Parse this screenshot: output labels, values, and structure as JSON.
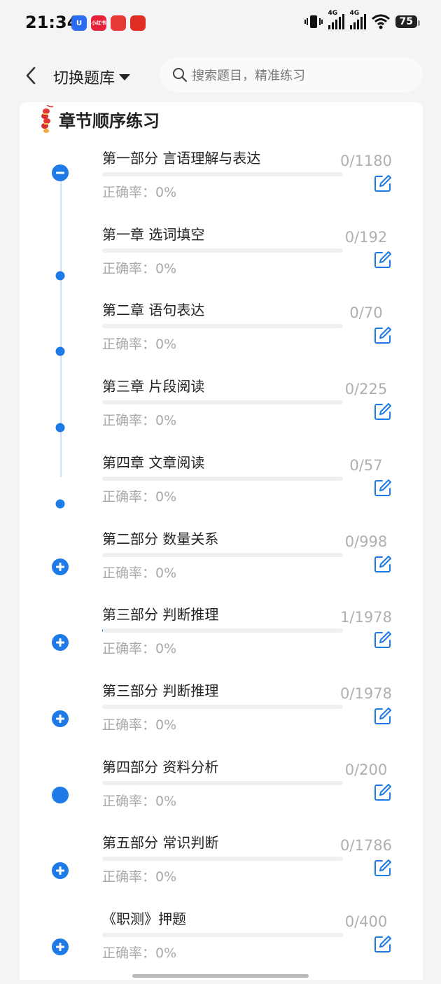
{
  "status": {
    "time": "21:34",
    "apps": [
      {
        "name": "app-u-icon",
        "color": "#2b6cf0",
        "label": "U"
      },
      {
        "name": "app-xiaohongshu-icon",
        "color": "#e5223a",
        "label": "小红书"
      },
      {
        "name": "app-red-tent-icon",
        "color": "#e53935",
        "label": ""
      },
      {
        "name": "app-pinduoduo-icon",
        "color": "#e02e24",
        "label": ""
      }
    ],
    "signal_label_1": "4G",
    "signal_label_2": "4G",
    "battery": "75"
  },
  "header": {
    "switch_label": "切换题库",
    "search_placeholder": "搜索题目，精准练习"
  },
  "section": {
    "title": "章节顺序练习"
  },
  "accent_color": "#1e7ae6",
  "items": [
    {
      "title": "第一部分 言语理解与表达",
      "accuracy": "正确率：0%",
      "count": "0/1180",
      "marker": "minus",
      "progress": 0
    },
    {
      "title": "第一章 选词填空",
      "accuracy": "正确率：0%",
      "count": "0/192",
      "marker": "dot",
      "progress": 0
    },
    {
      "title": "第二章 语句表达",
      "accuracy": "正确率：0%",
      "count": "0/70",
      "marker": "dot",
      "progress": 0
    },
    {
      "title": "第三章 片段阅读",
      "accuracy": "正确率：0%",
      "count": "0/225",
      "marker": "dot",
      "progress": 0
    },
    {
      "title": "第四章 文章阅读",
      "accuracy": "正确率：0%",
      "count": "0/57",
      "marker": "dot",
      "progress": 0
    },
    {
      "title": "第二部分 数量关系",
      "accuracy": "正确率：0%",
      "count": "0/998",
      "marker": "plus",
      "progress": 0
    },
    {
      "title": "第三部分 判断推理",
      "accuracy": "正确率：0%",
      "count": "1/1978",
      "marker": "plus",
      "progress": 0.0005
    },
    {
      "title": "第三部分 判断推理",
      "accuracy": "正确率：0%",
      "count": "0/1978",
      "marker": "plus",
      "progress": 0
    },
    {
      "title": "第四部分 资料分析",
      "accuracy": "正确率：0%",
      "count": "0/200",
      "marker": "filled",
      "progress": 0
    },
    {
      "title": "第五部分 常识判断",
      "accuracy": "正确率：0%",
      "count": "0/1786",
      "marker": "plus",
      "progress": 0
    },
    {
      "title": "《职测》押题",
      "accuracy": "正确率：0%",
      "count": "0/400",
      "marker": "plus",
      "progress": 0
    }
  ]
}
